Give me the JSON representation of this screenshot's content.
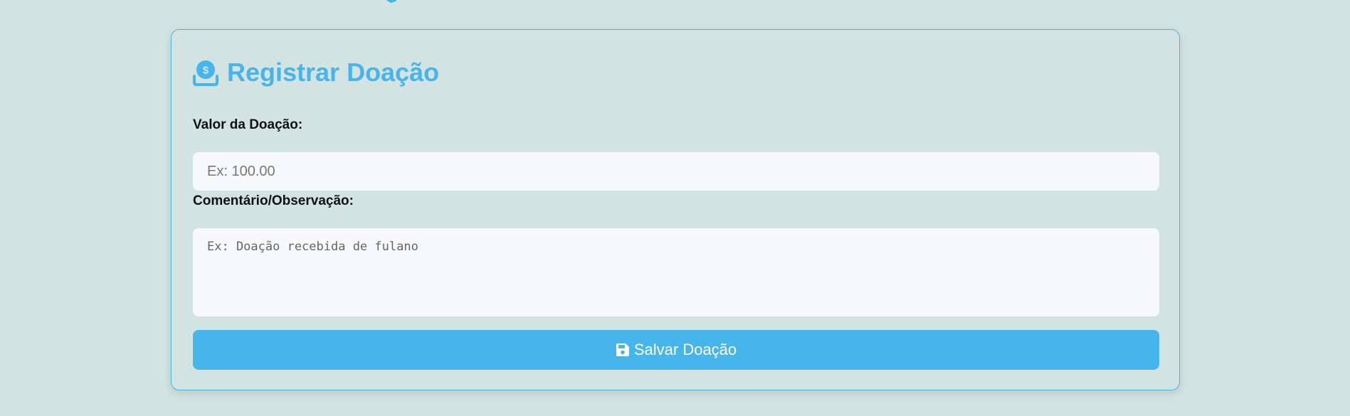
{
  "colors": {
    "background": "#d3e3e2",
    "accent": "#45b5ec",
    "input_background": "#f7f8fa",
    "label_text": "#111111",
    "button_text": "#ffffff"
  },
  "page": {
    "top_heading_fragment": "ç"
  },
  "form": {
    "title": "Registrar Doação",
    "title_icon": "hand-holding-dollar-icon",
    "fields": {
      "valor": {
        "label": "Valor da Doação:",
        "placeholder": "Ex: 100.00",
        "value": ""
      },
      "comentario": {
        "label": "Comentário/Observação:",
        "placeholder": "Ex: Doação recebida de fulano",
        "value": ""
      }
    },
    "submit": {
      "label": "Salvar Doação",
      "icon": "floppy-disk-icon"
    }
  }
}
